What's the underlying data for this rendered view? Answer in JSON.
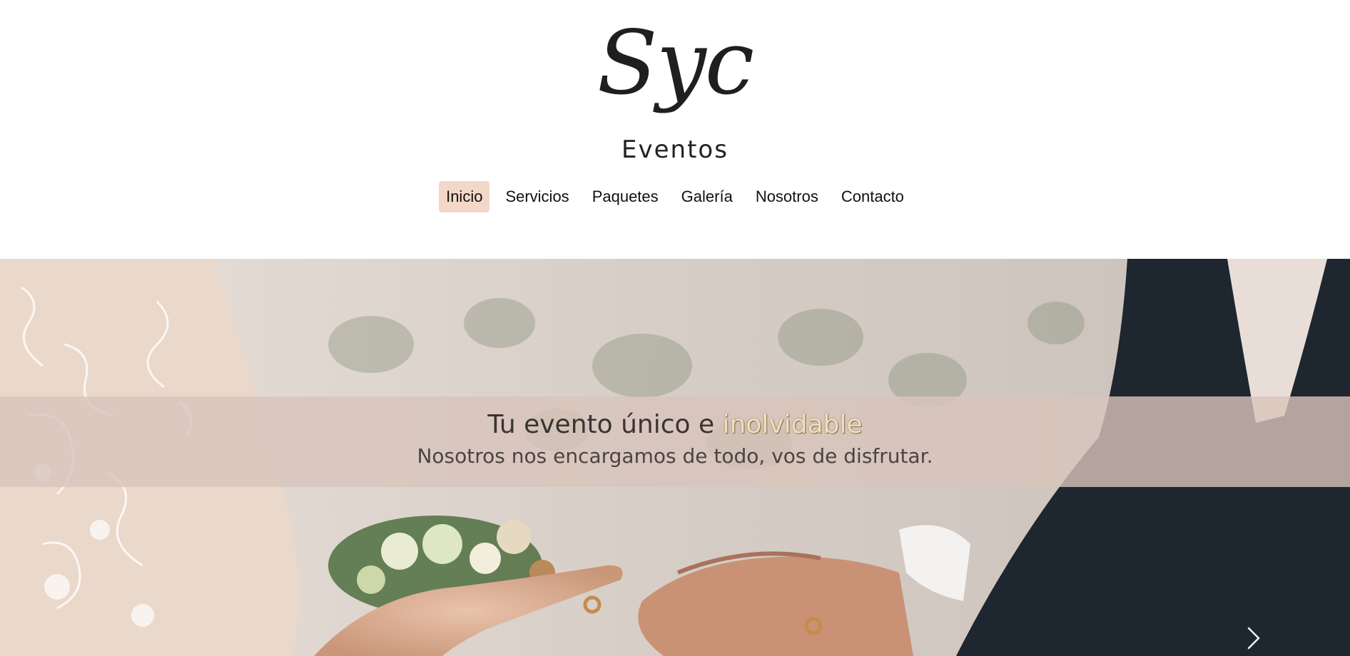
{
  "brand": {
    "logo_script": "Syc",
    "logo_subtitle": "Eventos"
  },
  "nav": {
    "items": [
      {
        "label": "Inicio",
        "active": true
      },
      {
        "label": "Servicios",
        "active": false
      },
      {
        "label": "Paquetes",
        "active": false
      },
      {
        "label": "Galería",
        "active": false
      },
      {
        "label": "Nosotros",
        "active": false
      },
      {
        "label": "Contacto",
        "active": false
      }
    ]
  },
  "hero": {
    "title_prefix": "Tu evento único e",
    "title_highlight": "inolvidable",
    "subtitle": "Nosotros nos encargamos de todo, vos de disfrutar.",
    "next_icon": "chevron-right-icon"
  },
  "colors": {
    "nav_active_bg": "#f3d8c9",
    "banner_bg": "#d8c4bc",
    "highlight_text": "#efe1b7"
  }
}
